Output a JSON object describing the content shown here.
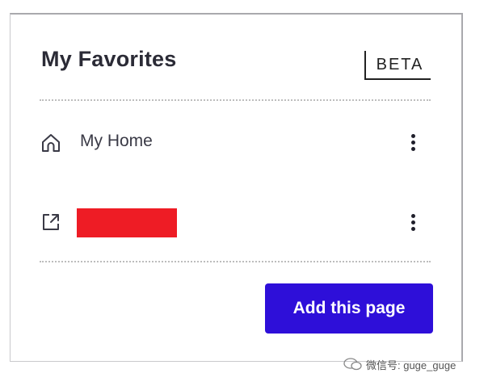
{
  "panel": {
    "title": "My Favorites",
    "badge": "BETA"
  },
  "favorites": [
    {
      "label": "My Home",
      "icon": "home-icon",
      "menu_icon": "more-vertical-icon"
    },
    {
      "label": "",
      "icon": "external-link-icon",
      "redacted": true,
      "redaction_color": "#ee1c25",
      "menu_icon": "more-vertical-icon"
    }
  ],
  "actions": {
    "add_label": "Add this page"
  },
  "watermark": {
    "text": "微信号: guge_guge",
    "icon": "wechat-icon"
  },
  "colors": {
    "accent": "#2e0fd9",
    "text": "#2b2b36",
    "redaction": "#ee1c25"
  }
}
